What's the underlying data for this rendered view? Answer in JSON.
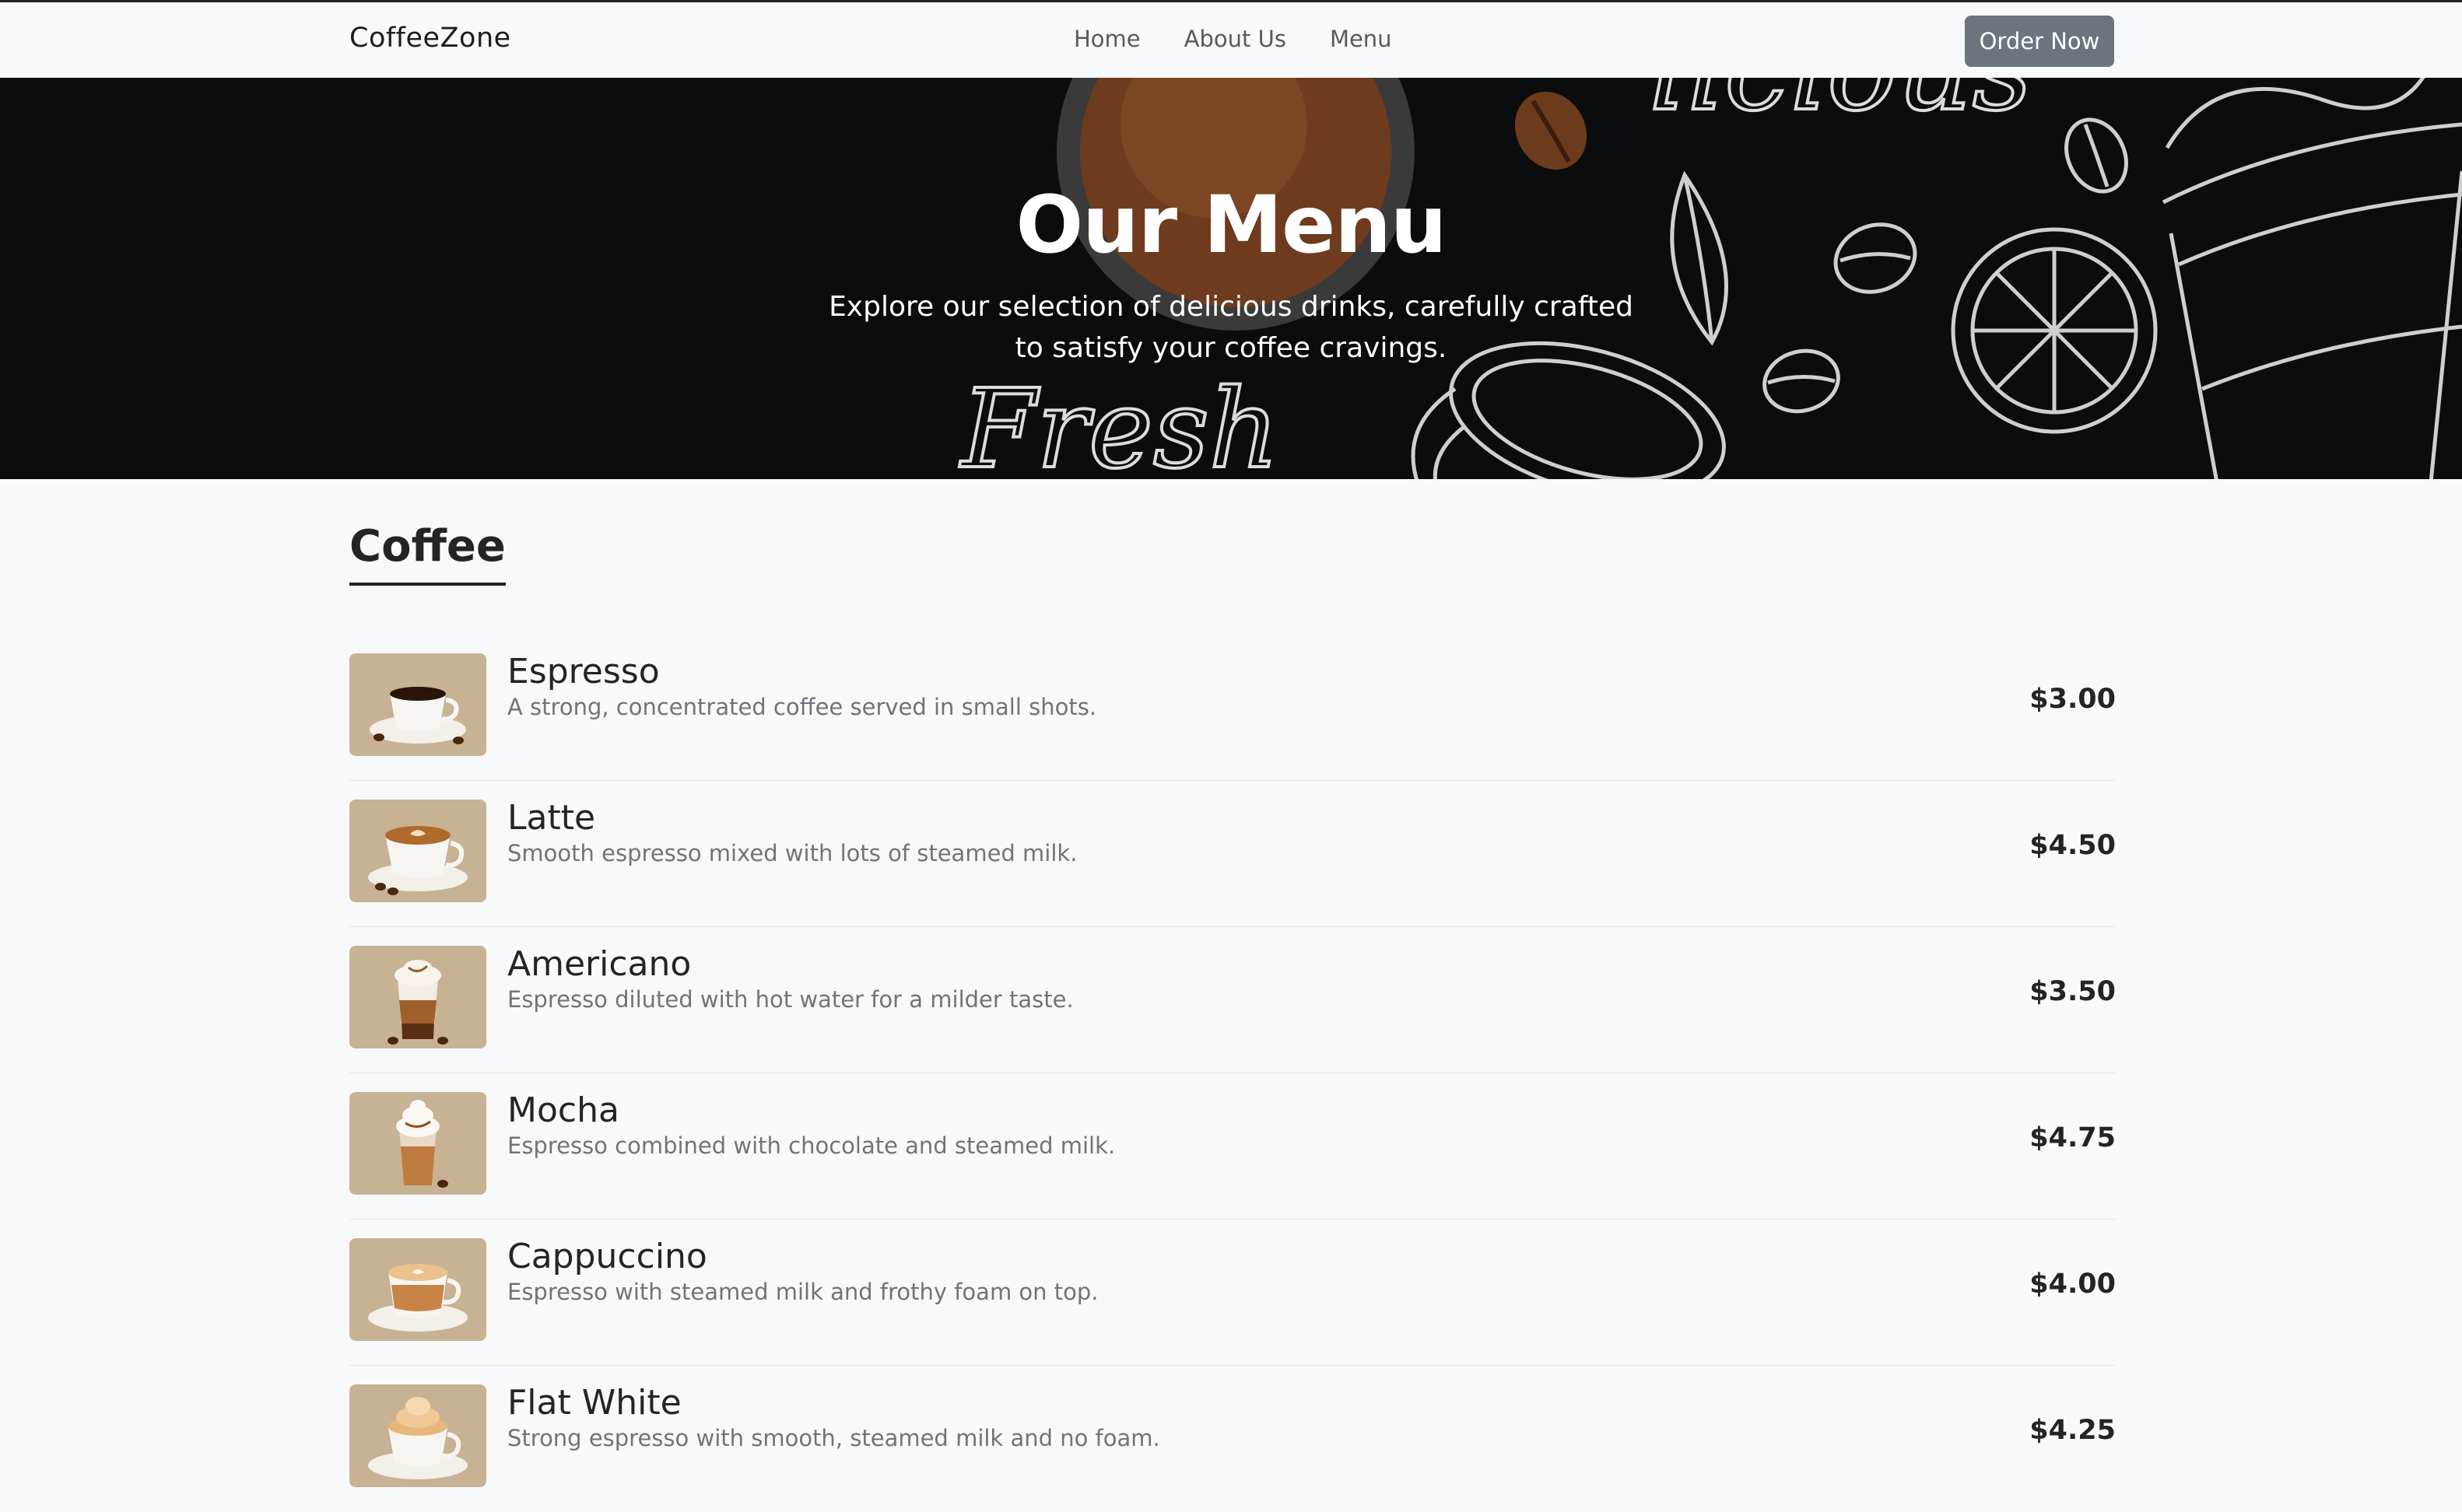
{
  "nav": {
    "brand": "CoffeeZone",
    "links": [
      {
        "label": "Home"
      },
      {
        "label": "About Us"
      },
      {
        "label": "Menu"
      }
    ],
    "cta_label": "Order Now"
  },
  "hero": {
    "title": "Our Menu",
    "subtitle": "Explore our selection of delicious drinks, carefully crafted to satisfy your coffee cravings.",
    "background_words": [
      "Fresh",
      "licious"
    ]
  },
  "section": {
    "title": "Coffee",
    "items": [
      {
        "name": "Espresso",
        "description": "A strong, concentrated coffee served in small shots.",
        "price": "$3.00",
        "icon": "espresso-cup-icon"
      },
      {
        "name": "Latte",
        "description": "Smooth espresso mixed with lots of steamed milk.",
        "price": "$4.50",
        "icon": "latte-cup-icon"
      },
      {
        "name": "Americano",
        "description": "Espresso diluted with hot water for a milder taste.",
        "price": "$3.50",
        "icon": "layered-glass-icon"
      },
      {
        "name": "Mocha",
        "description": "Espresso combined with chocolate and steamed milk.",
        "price": "$4.75",
        "icon": "whipped-glass-icon"
      },
      {
        "name": "Cappuccino",
        "description": "Espresso with steamed milk and frothy foam on top.",
        "price": "$4.00",
        "icon": "cappuccino-cup-icon"
      },
      {
        "name": "Flat White",
        "description": "Strong espresso with smooth, steamed milk and no foam.",
        "price": "$4.25",
        "icon": "cream-cup-icon"
      }
    ]
  },
  "colors": {
    "page_bg": "#f8f9fa",
    "hero_bg": "#0b0c0d",
    "button_bg": "#6c757d",
    "thumb_bg": "#c8b294",
    "muted_text": "#6c757d"
  }
}
